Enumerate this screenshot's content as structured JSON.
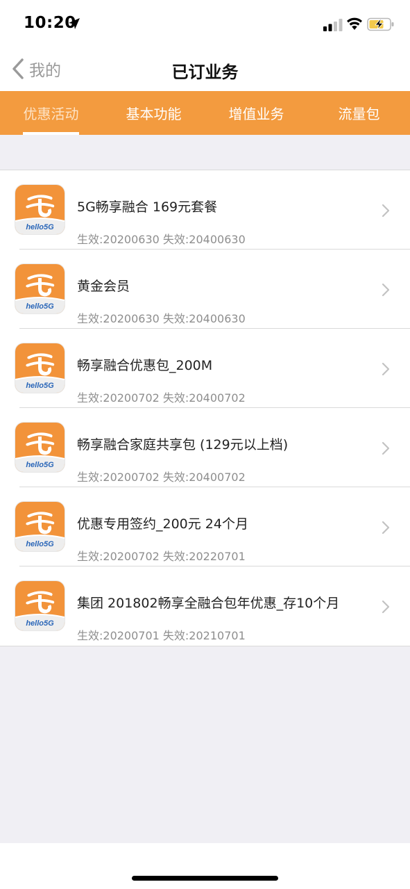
{
  "status": {
    "time": "10:20"
  },
  "nav": {
    "back_label": "我的",
    "title": "已订业务"
  },
  "tabs": [
    {
      "label": "优惠活动",
      "active": true
    },
    {
      "label": "基本功能",
      "active": false
    },
    {
      "label": "增值业务",
      "active": false
    },
    {
      "label": "流量包",
      "active": false
    }
  ],
  "icon_caption": "hello5G",
  "colors": {
    "accent": "#f39b3f",
    "tab_active_text": "#fde3c6"
  },
  "subscriptions": [
    {
      "title": "5G畅享融合 169元套餐",
      "dates": "生效:20200630 失效:20400630"
    },
    {
      "title": "黄金会员",
      "dates": "生效:20200630 失效:20400630"
    },
    {
      "title": "畅享融合优惠包_200M",
      "dates": "生效:20200702 失效:20400702"
    },
    {
      "title": "畅享融合家庭共享包 (129元以上档)",
      "dates": "生效:20200702 失效:20400702"
    },
    {
      "title": "优惠专用签约_200元 24个月",
      "dates": "生效:20200702 失效:20220701"
    },
    {
      "title": "集团 201802畅享全融合包年优惠_存10个月",
      "dates": "生效:20200701 失效:20210701"
    }
  ]
}
